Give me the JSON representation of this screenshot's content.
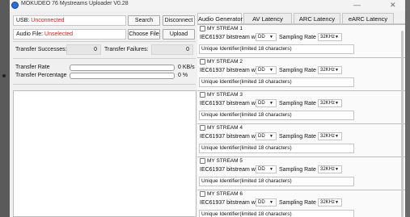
{
  "window": {
    "title": "MOKUDEO 76 Mystreams Uploader V0.28"
  },
  "usb": {
    "label": "USB:",
    "value": "Unconnected",
    "search_label": "Search",
    "disconnect_label": "Disconnect"
  },
  "audio_file": {
    "label": "Audio File:",
    "value": "Unselected",
    "choose_label": "Choose File",
    "upload_label": "Upload"
  },
  "transfer": {
    "successes_label": "Transfer Successes:",
    "successes_value": "0",
    "failures_label": "Transfer Failures:",
    "failures_value": "0",
    "rate_label": "Transfer Rate",
    "rate_value": "0",
    "rate_unit": "KB/s",
    "rate_fraction": 0,
    "percent_label": "Transfer Percentage",
    "percent_value": "0",
    "percent_unit": "%",
    "percent_fraction": 0
  },
  "tabs": [
    {
      "label": "Audio Generator",
      "active": true
    },
    {
      "label": "AV Latency",
      "active": false
    },
    {
      "label": "ARC Latency",
      "active": false
    },
    {
      "label": "eARC Latency",
      "active": false
    }
  ],
  "streams": [
    {
      "name": "MY STREAM 1",
      "bitstream_label": "IEC61937 bitstream with",
      "format": "DD",
      "rate_label": "Sampling Rate",
      "rate": "32KHz",
      "uid_placeholder": "Unique Identifier(limited 18 characters)",
      "checked": false
    },
    {
      "name": "MY STREAM 2",
      "bitstream_label": "IEC61937 bitstream with",
      "format": "DD",
      "rate_label": "Sampling Rate",
      "rate": "32KHz",
      "uid_placeholder": "Unique Identifier(limited 18 characters)",
      "checked": false
    },
    {
      "name": "MY STREAM 3",
      "bitstream_label": "IEC61937 bitstream with",
      "format": "DD",
      "rate_label": "Sampling Rate",
      "rate": "32KHz",
      "uid_placeholder": "Unique Identifier(limited 18 characters)",
      "checked": false
    },
    {
      "name": "MY STREAM 4",
      "bitstream_label": "IEC61937 bitstream with",
      "format": "DD",
      "rate_label": "Sampling Rate",
      "rate": "32KHz",
      "uid_placeholder": "Unique Identifier(limited 18 characters)",
      "checked": false
    },
    {
      "name": "MY STREAM 5",
      "bitstream_label": "IEC61937 bitstream with",
      "format": "DD",
      "rate_label": "Sampling Rate",
      "rate": "32KHz",
      "uid_placeholder": "Unique Identifier(limited 18 characters)",
      "checked": false
    },
    {
      "name": "MY STREAM 6",
      "bitstream_label": "IEC61937 bitstream with",
      "format": "DD",
      "rate_label": "Sampling Rate",
      "rate": "32KHz",
      "uid_placeholder": "Unique Identifier(limited 18 characters)",
      "checked": false
    }
  ],
  "icons": {
    "app": "app-icon",
    "minimize": "minimize-icon",
    "close": "close-icon",
    "dropdown": "chevron-down-icon"
  },
  "colors": {
    "status_red": "#e0191b",
    "accent": "#2a6fd6"
  }
}
